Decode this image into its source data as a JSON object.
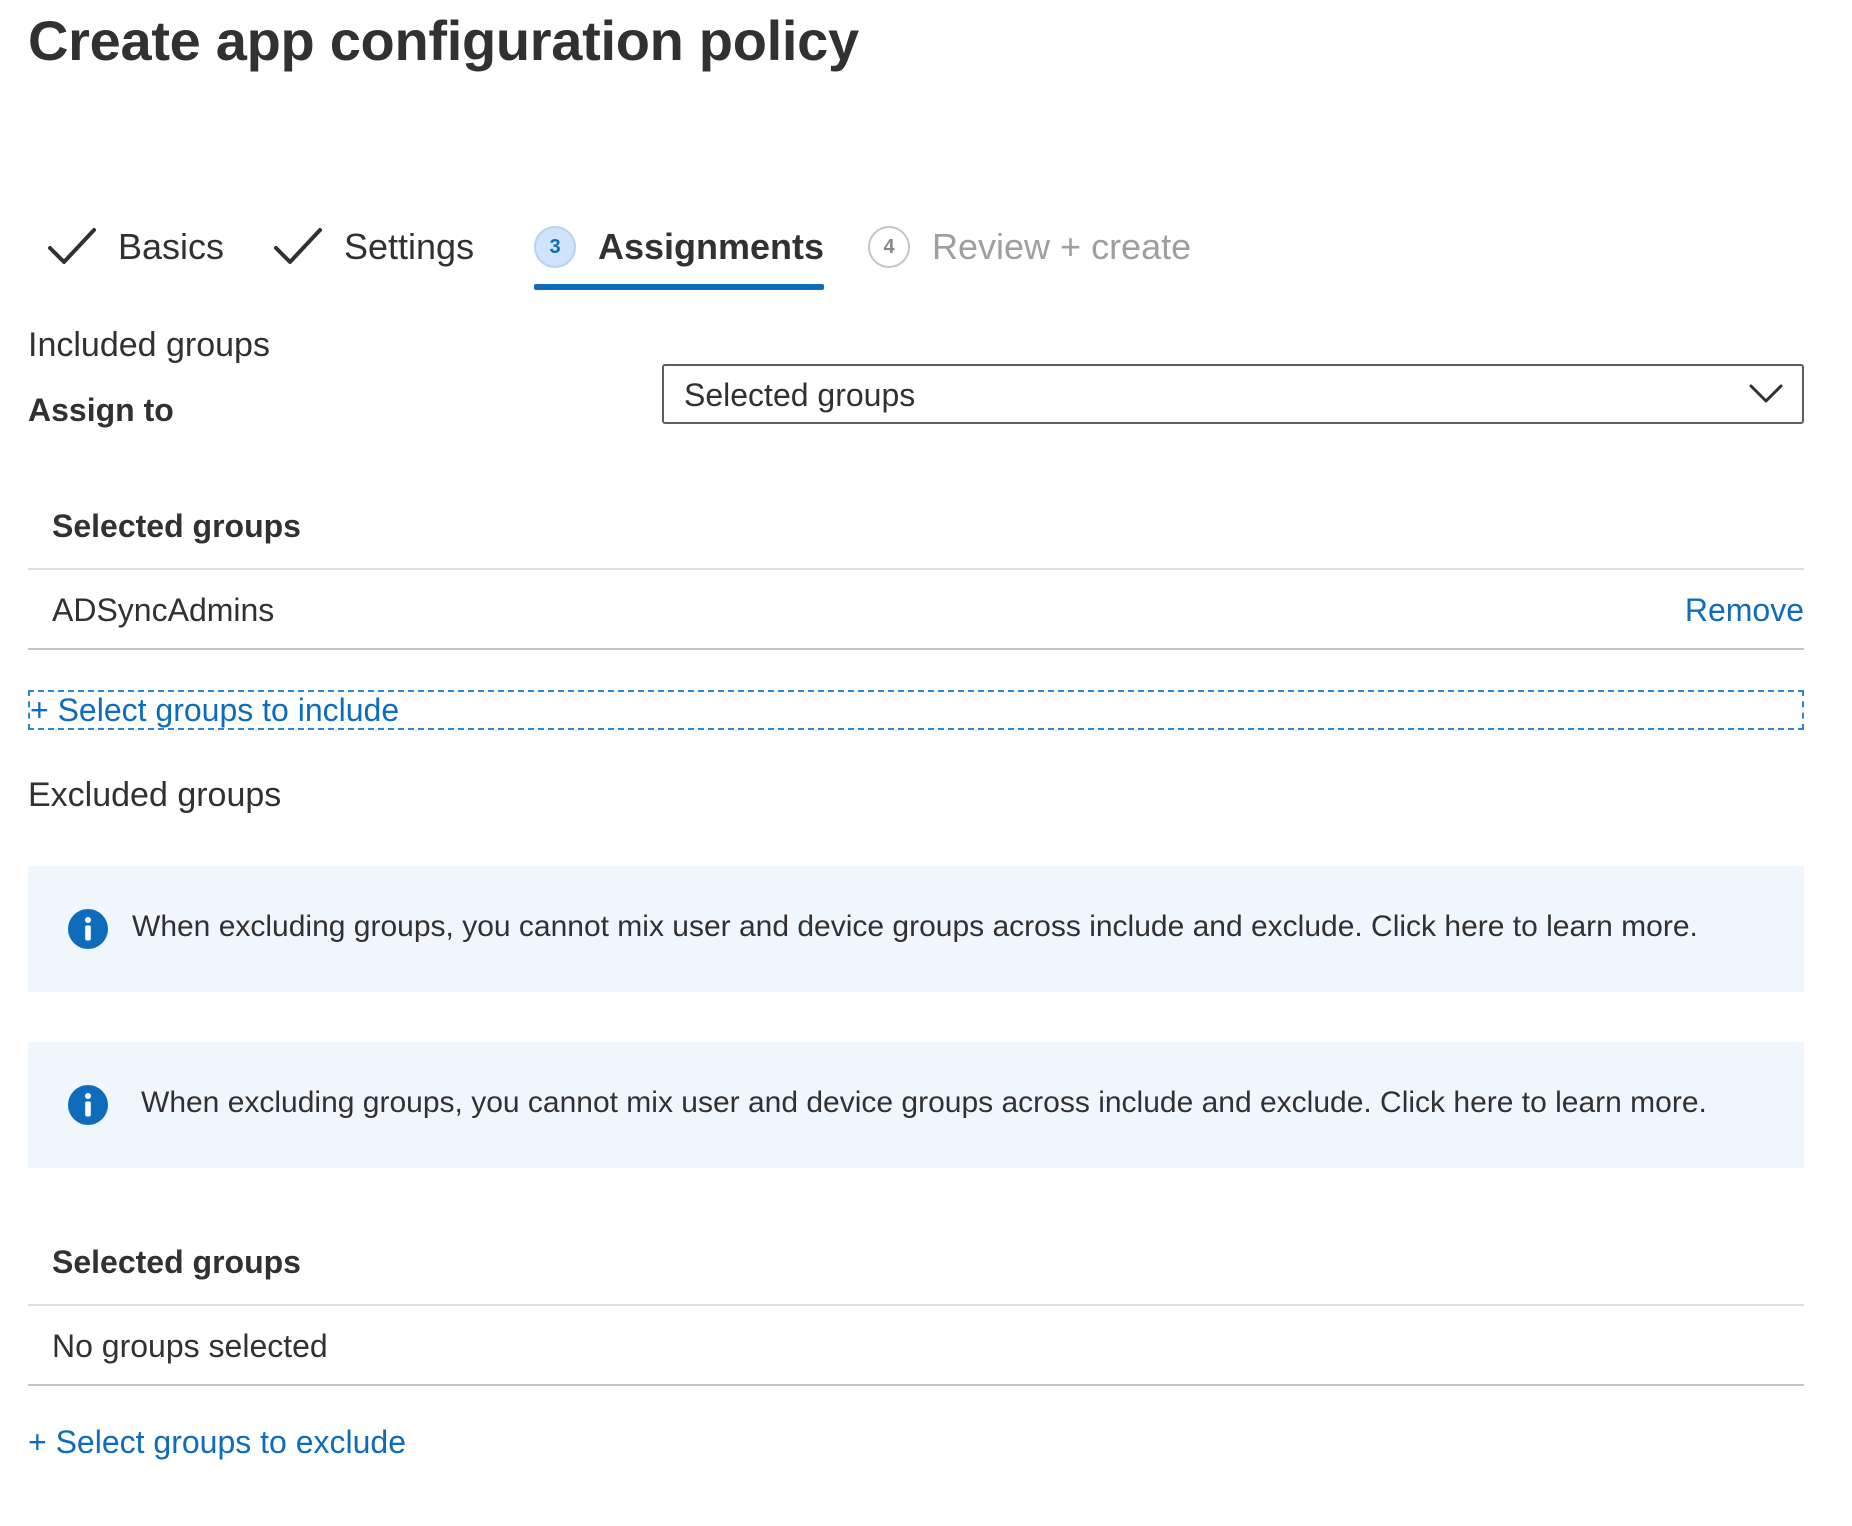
{
  "page": {
    "title": "Create app configuration policy"
  },
  "wizard": {
    "steps": [
      {
        "label": "Basics",
        "state": "completed",
        "icon": "check-icon"
      },
      {
        "label": "Settings",
        "state": "completed",
        "icon": "check-icon"
      },
      {
        "label": "Assignments",
        "state": "active",
        "number": "3"
      },
      {
        "label": "Review + create",
        "state": "disabled",
        "number": "4"
      }
    ]
  },
  "included": {
    "heading": "Included groups",
    "assign_to_label": "Assign to",
    "assign_to_value": "Selected groups",
    "table_header": "Selected groups",
    "rows": [
      {
        "name": "ADSyncAdmins",
        "action": "Remove"
      }
    ],
    "add_link": "+ Select groups to include"
  },
  "excluded": {
    "heading": "Excluded groups",
    "banners": [
      {
        "text": "When excluding groups, you cannot mix user and device groups across include and exclude.  Click here to learn more.",
        "icon": "info-icon"
      },
      {
        "text": "When excluding groups, you cannot mix user and device groups across include and exclude. Click here to learn more.",
        "icon": "info-icon"
      }
    ],
    "table_header": "Selected groups",
    "empty_text": "No groups selected",
    "add_link": "+ Select groups to exclude"
  },
  "colors": {
    "accent": "#0f6cbd",
    "banner_bg": "#eff6fc",
    "text": "#323130",
    "disabled_text": "#a19f9d"
  }
}
